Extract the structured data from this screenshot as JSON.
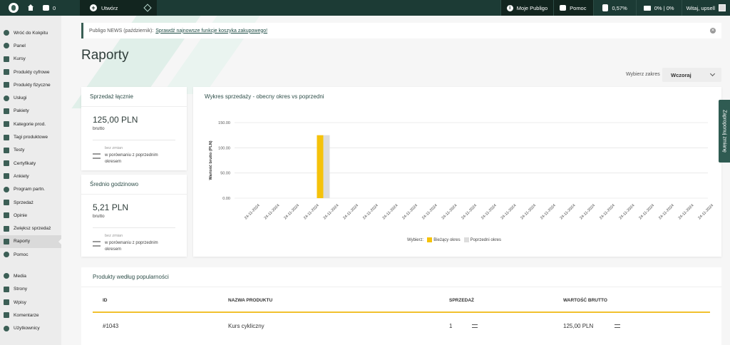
{
  "topbar": {
    "notifications_count": "0",
    "create_label": "Utwórz",
    "moje_publigo": "Moje Publigo",
    "help": "Pomoc",
    "disk_usage": "0,57%",
    "video_usage": "0% | 0%",
    "greeting": "Witaj, upsell"
  },
  "sidebar": {
    "items": [
      {
        "label": "Wróć do Kokpitu"
      },
      {
        "label": "Panel"
      },
      {
        "label": "Kursy"
      },
      {
        "label": "Produkty cyfrowe"
      },
      {
        "label": "Produkty fizyczne"
      },
      {
        "label": "Usługi"
      },
      {
        "label": "Pakiety"
      },
      {
        "label": "Kategorie prod."
      },
      {
        "label": "Tagi produktowe"
      },
      {
        "label": "Testy"
      },
      {
        "label": "Certyfikaty"
      },
      {
        "label": "Ankiety"
      },
      {
        "label": "Program partn."
      },
      {
        "label": "Sprzedaż"
      },
      {
        "label": "Opinie"
      },
      {
        "label": "Zwiększ sprzedaż"
      },
      {
        "label": "Raporty"
      },
      {
        "label": "Pomoc"
      }
    ],
    "items2": [
      {
        "label": "Media"
      },
      {
        "label": "Strony"
      },
      {
        "label": "Wpisy"
      },
      {
        "label": "Komentarze"
      },
      {
        "label": "Użytkownicy"
      }
    ]
  },
  "notice": {
    "prefix": "Publigo NEWS (październik):",
    "link": "Sprawdź najnowsze funkcje koszyka zakupowego!"
  },
  "page": {
    "title": "Raporty",
    "range_label": "Wybierz zakres",
    "range_value": "Wczoraj"
  },
  "sales_total": {
    "title": "Sprzedaż łącznie",
    "value": "125,00 PLN",
    "sub": "brutto",
    "cmp_small": "bez zmian",
    "cmp_text": "w porównaniu z poprzednim okresem"
  },
  "hourly_avg": {
    "title": "Średnio godzinowo",
    "value": "5,21 PLN",
    "sub": "brutto",
    "cmp_small": "bez zmian",
    "cmp_text": "w porównaniu z poprzednim okresem"
  },
  "chart_card": {
    "title": "Wykres sprzedaży - obecny okres vs poprzedni",
    "legend_prefix": "Wybierz:",
    "current_label": "Bieżący okres",
    "previous_label": "Poprzedni okres"
  },
  "chart_data": {
    "type": "bar",
    "ylabel": "Wartość brutto (PLN)",
    "ylim": [
      0,
      150
    ],
    "yticks": [
      "150.00",
      "100.00",
      "50.00",
      "0.00"
    ],
    "categories": [
      "24-11-2024",
      "24-11-2024",
      "24-11-2024",
      "24-11-2024",
      "24-11-2024",
      "24-11-2024",
      "24-11-2024",
      "24-11-2024",
      "24-11-2024",
      "24-11-2024",
      "24-11-2024",
      "24-11-2024",
      "24-11-2024",
      "24-11-2024",
      "24-11-2024",
      "24-11-2024",
      "24-11-2024",
      "24-11-2024",
      "24-11-2024",
      "24-11-2024",
      "24-11-2024",
      "24-11-2024",
      "24-11-2024",
      "24-11-2024"
    ],
    "series": [
      {
        "name": "Bieżący okres",
        "color": "#f5c20a",
        "values": [
          0,
          0,
          0,
          0,
          125,
          0,
          0,
          0,
          0,
          0,
          0,
          0,
          0,
          0,
          0,
          0,
          0,
          0,
          0,
          0,
          0,
          0,
          0,
          0
        ]
      },
      {
        "name": "Poprzedni okres",
        "color": "#dddddd",
        "values": [
          0,
          0,
          0,
          0,
          125,
          0,
          0,
          0,
          0,
          0,
          0,
          0,
          0,
          0,
          0,
          0,
          0,
          0,
          0,
          0,
          0,
          0,
          0,
          0
        ]
      }
    ]
  },
  "side_tab": "Zaproponuj zmianę",
  "products": {
    "title": "Produkty według popularności",
    "headers": {
      "id": "ID",
      "name": "NAZWA PRODUKTU",
      "sales": "SPRZEDAŻ",
      "value": "WARTOŚĆ BRUTTO"
    },
    "rows": [
      {
        "id": "#1043",
        "name": "Kurs cykliczny",
        "sales": "1",
        "value": "125,00 PLN"
      }
    ]
  },
  "colors": {
    "accent": "#1c3b35",
    "bar_current": "#f5c20a",
    "bar_previous": "#dddddd",
    "table_rule": "#f2c12e"
  }
}
